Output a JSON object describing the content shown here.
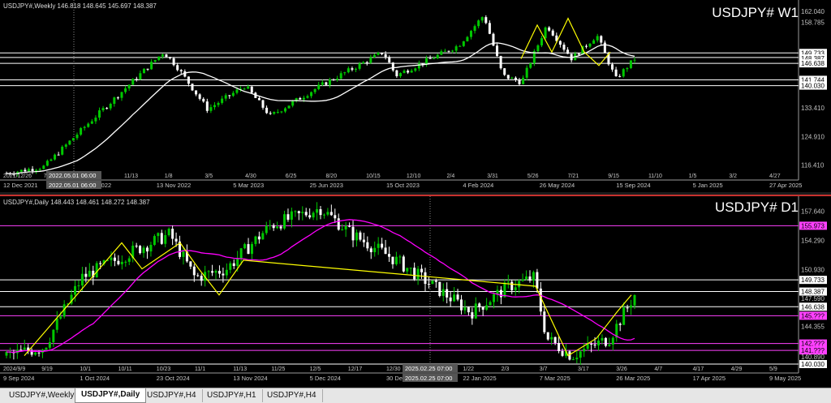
{
  "weekly": {
    "header": "USDJPY#,Weekly  146.818 148.645 145.697 148.387",
    "label": "USDJPY# W1",
    "price_labels": [
      {
        "text": "162.040",
        "price": 162.04,
        "color": "#c0c0c0"
      },
      {
        "text": "158.785",
        "price": 158.785,
        "color": "#c0c0c0"
      },
      {
        "text": "149.733",
        "price": 149.733,
        "color": "#ffffff"
      },
      {
        "text": "148.387",
        "price": 148.1,
        "color": "#ffffff"
      },
      {
        "text": "146.638",
        "price": 146.638,
        "color": "#ffffff"
      },
      {
        "text": "141.744",
        "price": 141.744,
        "color": "#ffffff"
      },
      {
        "text": "140.030",
        "price": 140.03,
        "color": "#ffffff"
      },
      {
        "text": "133.410",
        "price": 133.41,
        "color": "#c0c0c0"
      },
      {
        "text": "124.910",
        "price": 124.91,
        "color": "#c0c0c0"
      },
      {
        "text": "116.410",
        "price": 116.41,
        "color": "#c0c0c0"
      }
    ],
    "levels": [
      149.733,
      148.387,
      146.638,
      141.744,
      140.03
    ],
    "time_labels": [
      "12 Dec 2021",
      "24 Jul 2022",
      "13 Nov 2022",
      "5 Mar 2023",
      "25 Jun 2023",
      "15 Oct 2023",
      "4 Feb 2024",
      "26 May 2024",
      "15 Sep 2024",
      "5 Jan 2025",
      "27 Apr 2025"
    ],
    "top_time_labels": [
      "2021/12/26",
      "7/24",
      "9/18",
      "11/13",
      "1/8",
      "3/5",
      "4/30",
      "6/25",
      "8/20",
      "10/15",
      "12/10",
      "2/4",
      "3/31",
      "5/26",
      "7/21",
      "9/15",
      "11/10",
      "1/5",
      "3/2",
      "4/27"
    ],
    "crosshair_date": "2022.05.01 06:00"
  },
  "daily": {
    "header": "USDJPY#,Daily  148.443 148.461 148.272 148.387",
    "label": "USDJPY# D1",
    "price_labels": [
      {
        "text": "157.640",
        "price": 157.64,
        "color": "#c0c0c0"
      },
      {
        "text": "155.973",
        "price": 155.973,
        "color": "#ff40ff"
      },
      {
        "text": "154.290",
        "price": 154.29,
        "color": "#c0c0c0"
      },
      {
        "text": "150.930",
        "price": 150.93,
        "color": "#c0c0c0"
      },
      {
        "text": "149.733",
        "price": 149.733,
        "color": "#ffffff"
      },
      {
        "text": "148.387",
        "price": 148.387,
        "color": "#ffffff"
      },
      {
        "text": "147.590",
        "price": 147.59,
        "color": "#c0c0c0"
      },
      {
        "text": "146.638",
        "price": 146.638,
        "color": "#ffffff"
      },
      {
        "text": "145.???",
        "price": 145.6,
        "color": "#ff40ff"
      },
      {
        "text": "144.355",
        "price": 144.355,
        "color": "#c0c0c0"
      },
      {
        "text": "142.???",
        "price": 142.4,
        "color": "#ff40ff"
      },
      {
        "text": "141.???",
        "price": 141.6,
        "color": "#ff40ff"
      },
      {
        "text": "140.890",
        "price": 140.89,
        "color": "#c0c0c0"
      },
      {
        "text": "140.030",
        "price": 140.03,
        "color": "#ffffff"
      }
    ],
    "time_labels": [
      "9 Sep 2024",
      "1 Oct 2024",
      "23 Oct 2024",
      "13 Nov 2024",
      "5 Dec 2024",
      "30 Dec 2024",
      "22 Jan 2025",
      "7 Mar 2025",
      "26 Mar 2025",
      "17 Apr 2025",
      "9 May 2025"
    ],
    "top_time_labels": [
      "2024/9/9",
      "9/19",
      "10/1",
      "10/11",
      "10/23",
      "11/1",
      "11/13",
      "11/25",
      "12/5",
      "12/17",
      "12/30",
      "1/10",
      "1/22",
      "2/3",
      "3/7",
      "3/17",
      "3/26",
      "4/7",
      "4/17",
      "4/29",
      "5/9"
    ],
    "crosshair_date": "2025.02.25 07:00"
  },
  "tabs": [
    "USDJPY#,Weekly",
    "USDJPY#,Daily",
    "USDJPY#,H4",
    "USDJPY#,H1",
    "USDJPY#,H4"
  ],
  "active_tab": 1,
  "colors": {
    "bull": "#00c800",
    "bear": "#ffffff",
    "ma_weekly": "#ffffff",
    "ma_daily": "#ff00ff",
    "zigzag": "#ffff00",
    "level_magenta": "#ff40ff"
  }
}
